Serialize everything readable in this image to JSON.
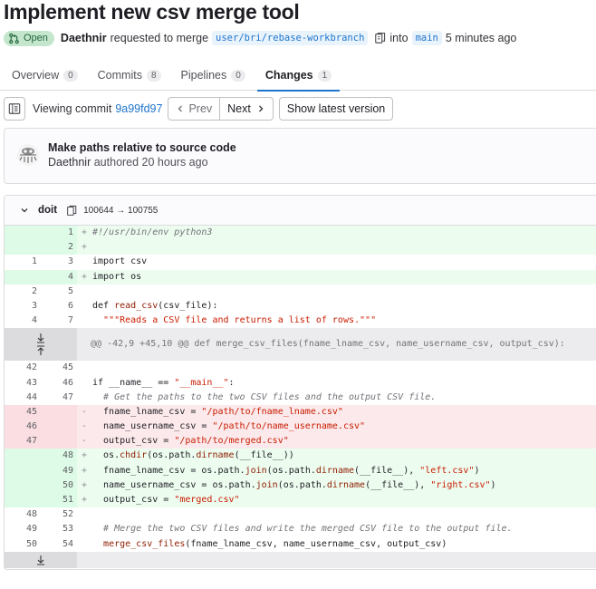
{
  "mr": {
    "title": "Implement new csv merge tool",
    "status": "Open",
    "author": "Daethnir",
    "requested_text": "requested to merge",
    "source_branch": "user/bri/rebase-workbranch",
    "into_text": "into",
    "target_branch": "main",
    "time": "5 minutes ago"
  },
  "tabs": [
    {
      "label": "Overview",
      "count": "0"
    },
    {
      "label": "Commits",
      "count": "8"
    },
    {
      "label": "Pipelines",
      "count": "0"
    },
    {
      "label": "Changes",
      "count": "1"
    }
  ],
  "commit_bar": {
    "viewing": "Viewing commit",
    "sha": "9a99fd97",
    "prev": "Prev",
    "next": "Next",
    "latest": "Show latest version"
  },
  "commit": {
    "title": "Make paths relative to source code",
    "author": "Daethnir",
    "authored": "authored 20 hours ago"
  },
  "file": {
    "name": "doit",
    "mode": "100644 → 100755"
  },
  "diff": {
    "block1": [
      {
        "type": "add",
        "old": "",
        "new": "1",
        "sign": "+",
        "code": "#!/usr/bin/env python3"
      },
      {
        "type": "add",
        "old": "",
        "new": "2",
        "sign": "+",
        "code": ""
      },
      {
        "type": "ctx",
        "old": "1",
        "new": "3",
        "sign": "",
        "code": "import csv"
      },
      {
        "type": "add",
        "old": "",
        "new": "4",
        "sign": "+",
        "code": "import os"
      },
      {
        "type": "ctx",
        "old": "2",
        "new": "5",
        "sign": "",
        "code": ""
      },
      {
        "type": "ctx",
        "old": "3",
        "new": "6",
        "sign": "",
        "code": "def read_csv(csv_file):"
      },
      {
        "type": "ctx",
        "old": "4",
        "new": "7",
        "sign": "",
        "code": "  \"\"\"Reads a CSV file and returns a list of rows.\"\"\""
      }
    ],
    "hunk": "@@ -42,9 +45,10 @@ def merge_csv_files(fname_lname_csv, name_username_csv, output_csv):",
    "block2": [
      {
        "type": "ctx",
        "old": "42",
        "new": "45",
        "sign": "",
        "code": ""
      },
      {
        "type": "ctx",
        "old": "43",
        "new": "46",
        "sign": "",
        "code": "if __name__ == \"__main__\":"
      },
      {
        "type": "ctx",
        "old": "44",
        "new": "47",
        "sign": "",
        "code": "  # Get the paths to the two CSV files and the output CSV file."
      },
      {
        "type": "del",
        "old": "45",
        "new": "",
        "sign": "-",
        "code": "  fname_lname_csv = \"/path/to/fname_lname.csv\""
      },
      {
        "type": "del",
        "old": "46",
        "new": "",
        "sign": "-",
        "code": "  name_username_csv = \"/path/to/name_username.csv\""
      },
      {
        "type": "del",
        "old": "47",
        "new": "",
        "sign": "-",
        "code": "  output_csv = \"/path/to/merged.csv\""
      },
      {
        "type": "add",
        "old": "",
        "new": "48",
        "sign": "+",
        "code": "  os.chdir(os.path.dirname(__file__))"
      },
      {
        "type": "add",
        "old": "",
        "new": "49",
        "sign": "+",
        "code": "  fname_lname_csv = os.path.join(os.path.dirname(__file__), \"left.csv\")"
      },
      {
        "type": "add",
        "old": "",
        "new": "50",
        "sign": "+",
        "code": "  name_username_csv = os.path.join(os.path.dirname(__file__), \"right.csv\")"
      },
      {
        "type": "add",
        "old": "",
        "new": "51",
        "sign": "+",
        "code": "  output_csv = \"merged.csv\""
      },
      {
        "type": "ctx",
        "old": "48",
        "new": "52",
        "sign": "",
        "code": ""
      },
      {
        "type": "ctx",
        "old": "49",
        "new": "53",
        "sign": "",
        "code": "  # Merge the two CSV files and write the merged CSV file to the output file."
      },
      {
        "type": "ctx",
        "old": "50",
        "new": "54",
        "sign": "",
        "code": "  merge_csv_files(fname_lname_csv, name_username_csv, output_csv)"
      }
    ]
  },
  "colors": {
    "accent": "#1f75cb",
    "add_bg": "#ecfdf0",
    "del_bg": "#fbe9eb",
    "badge_bg": "#c3e6cd"
  }
}
